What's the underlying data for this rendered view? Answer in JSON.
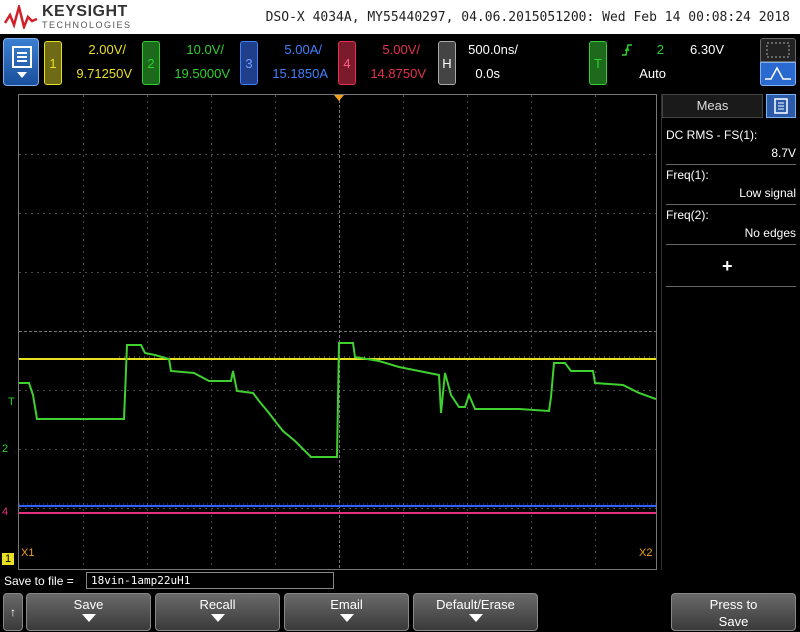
{
  "header": {
    "brand": "KEYSIGHT",
    "brand_sub": "TECHNOLOGIES",
    "title": "DSO-X 4034A, MY55440297, 04.06.2015051200: Wed Feb 14 00:08:24 2018"
  },
  "channels": [
    {
      "num": "1",
      "scale": "2.00V/",
      "offset": "9.71250V",
      "color": "#e8e020"
    },
    {
      "num": "2",
      "scale": "10.0V/",
      "offset": "19.5000V",
      "color": "#30d030"
    },
    {
      "num": "3",
      "scale": "5.00A/",
      "offset": "15.1850A",
      "color": "#4080ff"
    },
    {
      "num": "4",
      "scale": "5.00V/",
      "offset": "14.8750V",
      "color": "#e83050"
    }
  ],
  "horizontal": {
    "label": "H",
    "scale": "500.0ns/",
    "delay": "0.0s"
  },
  "trigger": {
    "label": "T",
    "slope_icon": "rising-edge-icon",
    "source": "2",
    "level": "6.30V",
    "mode": "Auto"
  },
  "markers": {
    "x1": "X1",
    "x2": "X2",
    "ch1": "1",
    "ch2": "2",
    "ch4": "4",
    "trig": "T"
  },
  "measurements": {
    "tab": "Meas",
    "items": [
      {
        "name": "DC RMS - FS(1):",
        "value": "8.7V"
      },
      {
        "name": "Freq(1):",
        "value": "Low signal"
      },
      {
        "name": "Freq(2):",
        "value": "No edges"
      }
    ],
    "add_label": "+"
  },
  "save": {
    "label": "Save to file =",
    "filename": "18vin-1amp22uH1"
  },
  "softkeys": {
    "back": "↑",
    "items": [
      "Save",
      "Recall",
      "Email",
      "Default/Erase"
    ],
    "press_to_save": "Press to",
    "press_to_save_2": "Save"
  }
}
